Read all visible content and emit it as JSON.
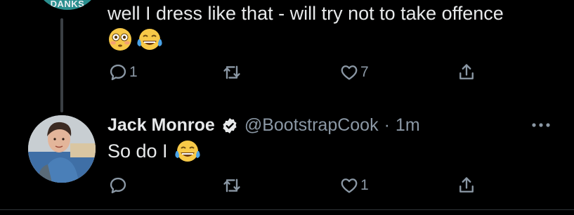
{
  "tweet1": {
    "avatar_label": "DANKS",
    "text": "well I dress like that - will try not to take offence",
    "emojis": [
      "flushed-face",
      "face-with-tears-of-joy"
    ],
    "reply_count": "1",
    "retweet_count": "",
    "like_count": "7"
  },
  "tweet2": {
    "name": "Jack Monroe",
    "handle": "@BootstrapCook",
    "separator": "·",
    "time": "1m",
    "text": "So do I",
    "emoji": "face-with-tears-of-joy",
    "reply_count": "",
    "retweet_count": "",
    "like_count": "1"
  },
  "colors": {
    "background": "#000000",
    "text": "#e7e9ea",
    "muted": "#8b98a5",
    "thread_line": "#3a3f44",
    "avatar_teal": "#2b8f8f"
  }
}
